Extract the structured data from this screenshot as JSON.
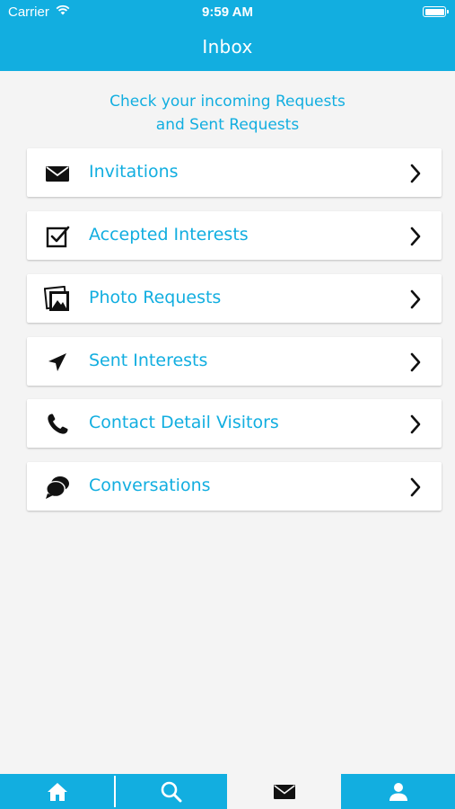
{
  "status_bar": {
    "carrier": "Carrier",
    "time": "9:59 AM",
    "icons": [
      "wifi-icon",
      "battery-icon"
    ]
  },
  "header": {
    "title": "Inbox"
  },
  "intro": {
    "line1": "Check your incoming Requests",
    "line2": "and Sent Requests"
  },
  "menu": {
    "items": [
      {
        "label": "Invitations",
        "icon": "envelope-icon"
      },
      {
        "label": "Accepted Interests",
        "icon": "checkbox-icon"
      },
      {
        "label": "Photo Requests",
        "icon": "photo-icon"
      },
      {
        "label": "Sent Interests",
        "icon": "send-icon"
      },
      {
        "label": "Contact Detail Visitors",
        "icon": "phone-icon"
      },
      {
        "label": "Conversations",
        "icon": "chat-bubbles-icon"
      }
    ]
  },
  "tabbar": {
    "tabs": [
      {
        "icon": "home-icon",
        "active": false
      },
      {
        "icon": "search-icon",
        "active": false
      },
      {
        "icon": "envelope-icon",
        "active": true
      },
      {
        "icon": "user-icon",
        "active": false
      }
    ]
  },
  "colors": {
    "accent": "#12aee0",
    "background": "#f4f4f4",
    "card": "#ffffff",
    "icon": "#111111"
  }
}
